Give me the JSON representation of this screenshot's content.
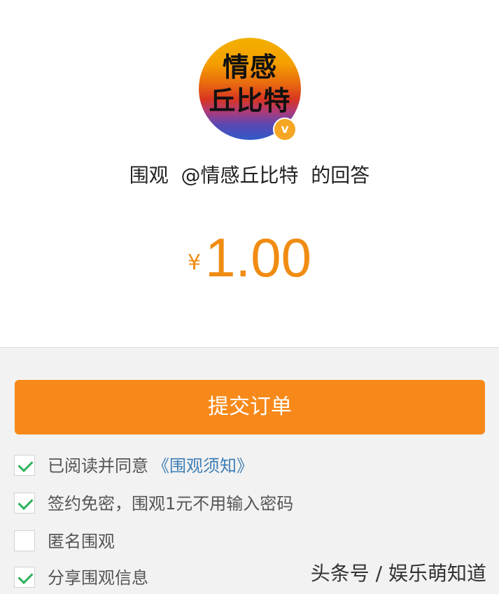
{
  "avatar": {
    "line1": "情感",
    "line2": "丘比特",
    "badge": "v"
  },
  "header": {
    "title": "围观  @情感丘比特  的回答"
  },
  "price": {
    "currency": "¥",
    "amount": "1.00"
  },
  "submit": {
    "label": "提交订单"
  },
  "options": [
    {
      "label": "已阅读并同意",
      "link": "《围观须知》",
      "checked": true
    },
    {
      "label": "签约免密，围观1元不用输入密码",
      "checked": true
    },
    {
      "label": "匿名围观",
      "checked": false
    },
    {
      "label": "分享围观信息",
      "checked": true
    }
  ],
  "watermark": "头条号 / 娱乐萌知道",
  "colors": {
    "accent": "#f7891a",
    "price": "#f08c13",
    "check": "#2fb15a",
    "link": "#3f7fb6"
  }
}
